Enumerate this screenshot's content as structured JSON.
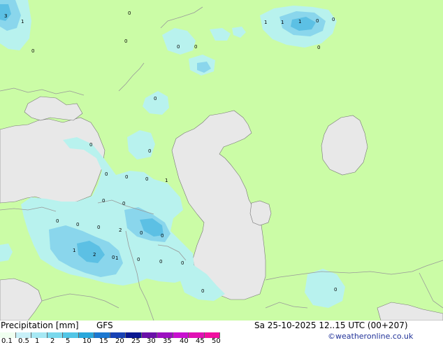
{
  "footer": {
    "title": "Precipitation [mm]",
    "model": "GFS",
    "valid_time": "Sa 25-10-2025 12..15 UTC (00+207)",
    "credit": "©weatheronline.co.uk"
  },
  "legend": {
    "ticks": [
      "0.1",
      "0.5",
      "1",
      "2",
      "5",
      "10",
      "15",
      "20",
      "25",
      "30",
      "35",
      "40",
      "45",
      "50"
    ],
    "colors": [
      "#f0fff0",
      "#c8f0f8",
      "#a6e8f4",
      "#7ad8ec",
      "#52c6e6",
      "#2aa8dc",
      "#1c78d0",
      "#1842b4",
      "#0b1890",
      "#6a10a8",
      "#9c10c0",
      "#c810d0",
      "#e010b4",
      "#f010a0"
    ]
  },
  "colors": {
    "land": "#cbfca6",
    "water": "#e8e8e8",
    "precip_light": "#b8f2ee",
    "precip_medium": "#8ad6ec",
    "precip_heavy": "#5cc0e4",
    "border": "#999999"
  },
  "map_labels": [
    "3",
    "1",
    "0",
    "0",
    "0",
    "0",
    "0",
    "1",
    "1",
    "1",
    "0",
    "0",
    "0",
    "0",
    "0",
    "0",
    "0",
    "0",
    "0",
    "1",
    "0",
    "0",
    "0",
    "0",
    "0",
    "2",
    "0",
    "1",
    "2",
    "0",
    "1",
    "0",
    "0",
    "0",
    "0",
    "0",
    "0"
  ]
}
